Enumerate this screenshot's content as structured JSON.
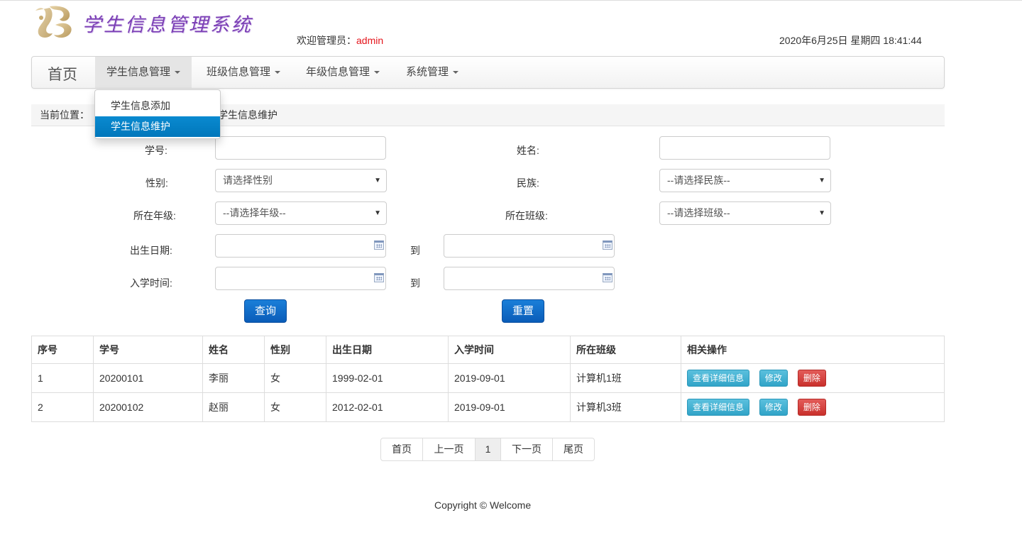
{
  "header": {
    "logo_text": "学生信息管理系统",
    "welcome_label": "欢迎管理员：",
    "username": "admin",
    "datetime": "2020年6月25日 星期四 18:41:44"
  },
  "navbar": {
    "brand": "首页",
    "items": [
      {
        "label": "学生信息管理"
      },
      {
        "label": "班级信息管理"
      },
      {
        "label": "年级信息管理"
      },
      {
        "label": "系统管理"
      }
    ],
    "dropdown": [
      {
        "label": "学生信息添加"
      },
      {
        "label": "学生信息维护"
      }
    ]
  },
  "breadcrumb": {
    "label": "当前位置：",
    "current": "学生信息维护"
  },
  "form": {
    "student_id_label": "学号:",
    "name_label": "姓名:",
    "gender_label": "性别:",
    "gender_value": "请选择性别",
    "ethnicity_label": "民族:",
    "ethnicity_value": "--请选择民族--",
    "grade_label": "所在年级:",
    "grade_value": "--请选择年级--",
    "class_label": "所在班级:",
    "class_value": "--请选择班级--",
    "birth_label": "出生日期:",
    "enroll_label": "入学时间:",
    "to_label": "到",
    "query_button": "查询",
    "reset_button": "重置"
  },
  "table": {
    "headers": [
      "序号",
      "学号",
      "姓名",
      "性别",
      "出生日期",
      "入学时间",
      "所在班级",
      "相关操作"
    ],
    "rows": [
      {
        "index": "1",
        "student_id": "20200101",
        "name": "李丽",
        "gender": "女",
        "birth": "1999-02-01",
        "enroll": "2019-09-01",
        "class": "计算机1班"
      },
      {
        "index": "2",
        "student_id": "20200102",
        "name": "赵丽",
        "gender": "女",
        "birth": "2012-02-01",
        "enroll": "2019-09-01",
        "class": "计算机3班"
      }
    ],
    "actions": {
      "detail": "查看详细信息",
      "edit": "修改",
      "delete": "删除"
    }
  },
  "pagination": {
    "first": "首页",
    "prev": "上一页",
    "current": "1",
    "next": "下一页",
    "last": "尾页"
  },
  "footer": "Copyright © Welcome",
  "colors": {
    "accent": "#0077bb",
    "primary_button": "#0a5cb8",
    "info_button": "#31a4c8",
    "danger_button": "#c9302c",
    "username": "#e4141b"
  },
  "icons": {
    "calendar": "calendar-icon",
    "dropdown": "caret-down-icon"
  }
}
